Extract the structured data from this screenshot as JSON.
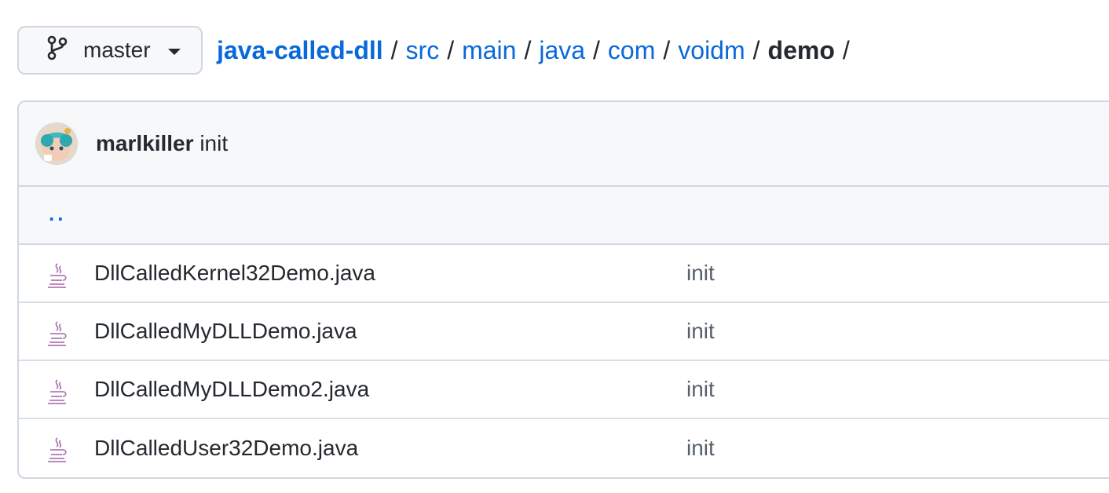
{
  "branch": {
    "name": "master"
  },
  "breadcrumb": {
    "repo": "java-called-dll",
    "path": [
      "src",
      "main",
      "java",
      "com",
      "voidm"
    ],
    "current": "demo",
    "separator": "/"
  },
  "commit": {
    "author": "marlkiller",
    "message": "init"
  },
  "parent_link": "..",
  "files": [
    {
      "name": "DllCalledKernel32Demo.java",
      "message": "init"
    },
    {
      "name": "DllCalledMyDLLDemo.java",
      "message": "init"
    },
    {
      "name": "DllCalledMyDLLDemo2.java",
      "message": "init"
    },
    {
      "name": "DllCalledUser32Demo.java",
      "message": "init"
    }
  ],
  "icons": {
    "branch": "git-branch-icon",
    "caret": "caret-down-icon",
    "file": "java-file-icon",
    "avatar": "user-avatar"
  },
  "colors": {
    "link": "#0969da",
    "border": "#d0d7de",
    "header_bg": "#f6f8fa",
    "java_icon": "#b07ab0"
  }
}
